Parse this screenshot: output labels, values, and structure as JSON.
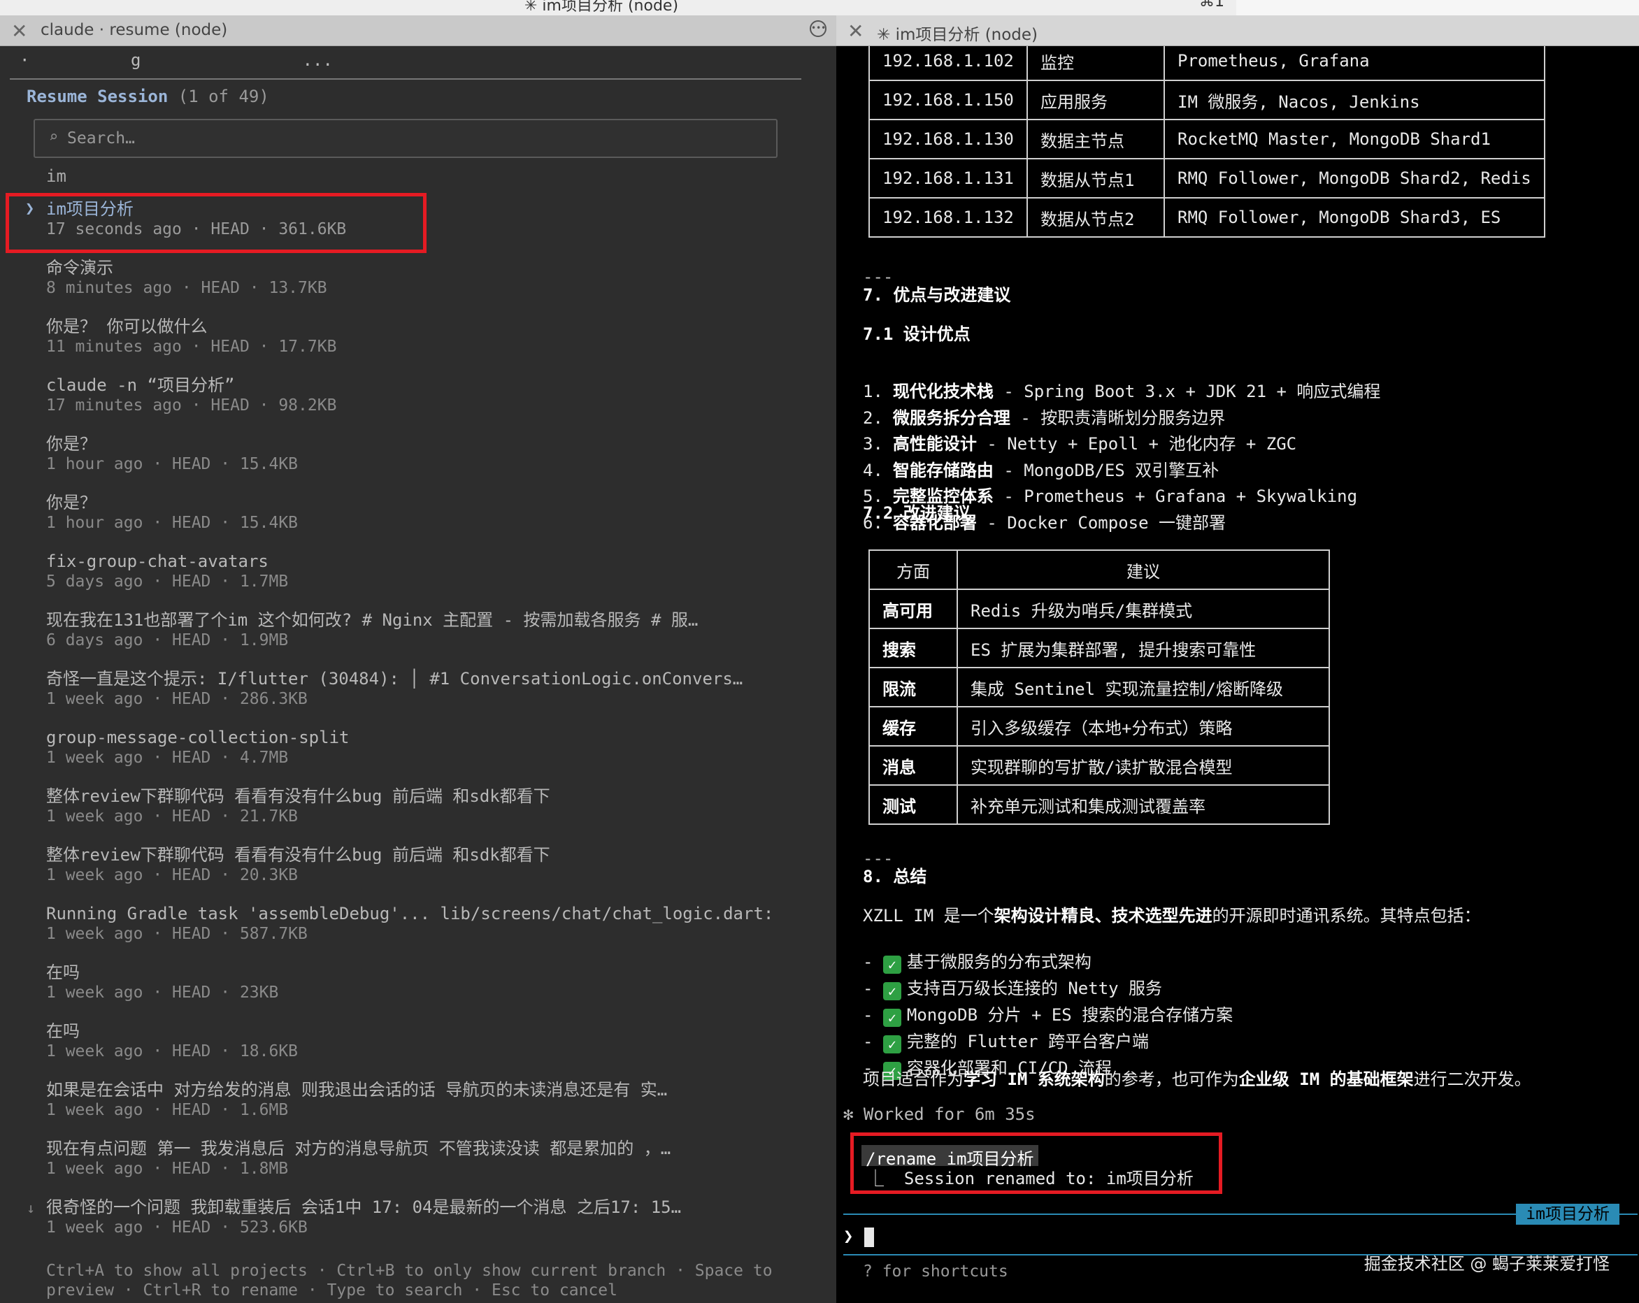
{
  "window": {
    "title": "✳ im项目分析 (node)",
    "right_title": "⌘1"
  },
  "tabs": {
    "left": {
      "label": "claude · resume (node)"
    },
    "right": {
      "label": "✳ im项目分析 (node)"
    }
  },
  "left": {
    "top_dots": "·          g                ...",
    "resume_title": "Resume Session",
    "resume_count": "(1 of 49)",
    "search_placeholder": "Search…",
    "query": "im",
    "sessions": [
      {
        "title": "im项目分析",
        "meta": "17 seconds ago · HEAD · 361.6KB"
      },
      {
        "title": "命令演示",
        "meta": "8 minutes ago · HEAD · 13.7KB"
      },
      {
        "title": "你是？ 你可以做什么",
        "meta": "11 minutes ago · HEAD · 17.7KB"
      },
      {
        "title": "claude -n “项目分析”",
        "meta": "17 minutes ago · HEAD · 98.2KB"
      },
      {
        "title": "你是？",
        "meta": "1 hour ago · HEAD · 15.4KB"
      },
      {
        "title": "你是？",
        "meta": "1 hour ago · HEAD · 15.4KB"
      },
      {
        "title": "fix-group-chat-avatars",
        "meta": "5 days ago · HEAD · 1.7MB"
      },
      {
        "title": "现在我在131也部署了个im 这个如何改? # Nginx 主配置 - 按需加载各服务 # 服…",
        "meta": "6 days ago · HEAD · 1.9MB"
      },
      {
        "title": "奇怪一直是这个提示:  I/flutter (30484): │ #1 ConversationLogic.onConvers…",
        "meta": "1 week ago · HEAD · 286.3KB"
      },
      {
        "title": "group-message-collection-split",
        "meta": "1 week ago · HEAD · 4.7MB"
      },
      {
        "title": "整体review下群聊代码 看看有没有什么bug 前后端 和sdk都看下",
        "meta": "1 week ago · HEAD · 21.7KB"
      },
      {
        "title": "整体review下群聊代码 看看有没有什么bug 前后端 和sdk都看下",
        "meta": "1 week ago · HEAD · 20.3KB"
      },
      {
        "title": "Running Gradle task 'assembleDebug'... lib/screens/chat/chat_logic.dart:…",
        "meta": "1 week ago · HEAD · 587.7KB"
      },
      {
        "title": "在吗",
        "meta": "1 week ago · HEAD · 23KB"
      },
      {
        "title": "在吗",
        "meta": "1 week ago · HEAD · 18.6KB"
      },
      {
        "title": "如果是在会话中 对方给发的消息 则我退出会话的话 导航页的未读消息还是有 实…",
        "meta": "1 week ago · HEAD · 1.6MB"
      },
      {
        "title": "现在有点问题 第一 我发消息后 对方的消息导航页 不管我读没读 都是累加的 ，…",
        "meta": "1 week ago · HEAD · 1.8MB"
      },
      {
        "title": "很奇怪的一个问题 我卸载重装后 会话1中 17: 04是最新的一个消息 之后17: 15…",
        "meta": "1 week ago · HEAD · 523.6KB"
      }
    ],
    "selected_arrow": "❯",
    "scroll_arrow": "↓",
    "footer_line1": "Ctrl+A to show all projects · Ctrl+B to only show current branch · Space to",
    "footer_line2": "preview · Ctrl+R to rename · Type to search · Esc to cancel"
  },
  "right": {
    "ip_table": [
      [
        "192.168.1.102",
        "监控",
        "Prometheus, Grafana"
      ],
      [
        "192.168.1.150",
        "应用服务",
        "IM 微服务, Nacos, Jenkins"
      ],
      [
        "192.168.1.130",
        "数据主节点",
        "RocketMQ Master, MongoDB Shard1"
      ],
      [
        "192.168.1.131",
        "数据从节点1",
        "RMQ Follower, MongoDB Shard2, Redis"
      ],
      [
        "192.168.1.132",
        "数据从节点2",
        "RMQ Follower, MongoDB Shard3, ES"
      ]
    ],
    "sep1": "---",
    "h7": "7. 优点与改进建议",
    "h71": "7.1 设计优点",
    "merits": [
      {
        "num": "1.",
        "key": "现代化技术栈",
        "desc": " - Spring Boot 3.x + JDK 21 + 响应式编程"
      },
      {
        "num": "2.",
        "key": "微服务拆分合理",
        "desc": " - 按职责清晰划分服务边界"
      },
      {
        "num": "3.",
        "key": "高性能设计",
        "desc": " - Netty + Epoll + 池化内存 + ZGC"
      },
      {
        "num": "4.",
        "key": "智能存储路由",
        "desc": " - MongoDB/ES 双引擎互补"
      },
      {
        "num": "5.",
        "key": "完整监控体系",
        "desc": " - Prometheus + Grafana + Skywalking"
      },
      {
        "num": "6.",
        "key": "容器化部署",
        "desc": " - Docker Compose 一键部署"
      }
    ],
    "h72": "7.2 改进建议",
    "sug_headers": [
      "方面",
      "建议"
    ],
    "sug_rows": [
      [
        "高可用",
        "Redis 升级为哨兵/集群模式"
      ],
      [
        "搜索",
        "ES 扩展为集群部署, 提升搜索可靠性"
      ],
      [
        "限流",
        "集成 Sentinel 实现流量控制/熔断降级"
      ],
      [
        "缓存",
        "引入多级缓存（本地+分布式）策略"
      ],
      [
        "消息",
        "实现群聊的写扩散/读扩散混合模型"
      ],
      [
        "测试",
        "补充单元测试和集成测试覆盖率"
      ]
    ],
    "sep2": "---",
    "h8": "8. 总结",
    "summary_pre": "XZLL IM 是一个",
    "summary_bold": "架构设计精良、技术选型先进",
    "summary_post": "的开源即时通讯系统。其特点包括：",
    "features": [
      "基于微服务的分布式架构",
      "支持百万级长连接的 Netty 服务",
      "MongoDB 分片 + ES 搜索的混合存储方案",
      "完整的 Flutter 跨平台客户端",
      "容器化部署和 CI/CD 流程"
    ],
    "check_glyph": "✓",
    "conc_1": "项目适合作为",
    "conc_b1": "学习 IM 系统架构",
    "conc_2": "的参考，也可作为",
    "conc_b2": "企业级 IM 的基础框架",
    "conc_3": "进行二次开发。",
    "worked": "✻ Worked for 6m 35s",
    "rename_cmd": "/rename im项目分析",
    "rename_result": "⎿  Session renamed to: im项目分析",
    "session_tag": "im项目分析",
    "prompt": "❯",
    "shortcuts": "? for shortcuts",
    "watermark": "掘金技术社区 @ 蝎子莱莱爱打怪"
  }
}
